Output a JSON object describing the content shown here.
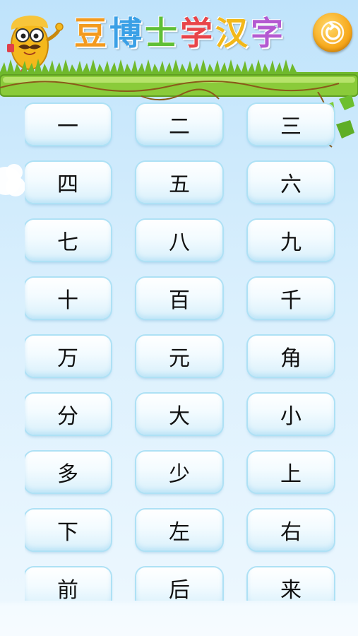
{
  "header": {
    "title_chars": [
      {
        "char": "豆",
        "color": "#f39a1e"
      },
      {
        "char": "博",
        "color": "#3aa0e6"
      },
      {
        "char": "士",
        "color": "#5fbf35"
      },
      {
        "char": "学",
        "color": "#e8454a"
      },
      {
        "char": "汉",
        "color": "#f2b81a"
      },
      {
        "char": "字",
        "color": "#b45ad1"
      }
    ],
    "back_icon": "refresh-back-icon",
    "mascot_icon": "mascot-character-icon"
  },
  "characters": [
    [
      "一",
      "二",
      "三"
    ],
    [
      "四",
      "五",
      "六"
    ],
    [
      "七",
      "八",
      "九"
    ],
    [
      "十",
      "百",
      "千"
    ],
    [
      "万",
      "元",
      "角"
    ],
    [
      "分",
      "大",
      "小"
    ],
    [
      "多",
      "少",
      "上"
    ],
    [
      "下",
      "左",
      "右"
    ],
    [
      "前",
      "后",
      "来"
    ]
  ],
  "colors": {
    "card_border": "#aee1f5",
    "grass": "#7cc23a",
    "back_button": "#f7a91c"
  }
}
